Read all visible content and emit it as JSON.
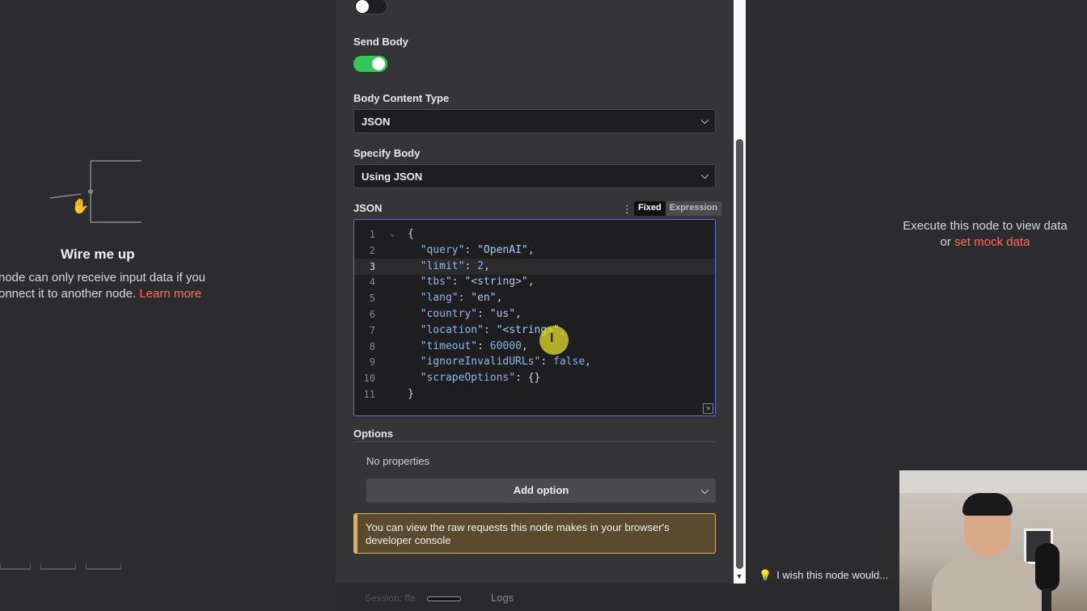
{
  "left": {
    "title": "Wire me up",
    "message": "node can only receive input data if you",
    "message2": "onnect it to another node.",
    "learn_more": "Learn more"
  },
  "params": {
    "send_body_label": "Send Body",
    "body_content_type_label": "Body Content Type",
    "body_content_type_value": "JSON",
    "specify_body_label": "Specify Body",
    "specify_body_value": "Using JSON",
    "json_label": "JSON",
    "mode_fixed": "Fixed",
    "mode_expression": "Expression"
  },
  "json_lines": [
    {
      "n": "1",
      "text": "{"
    },
    {
      "n": "2",
      "key": "\"query\"",
      "value": "\"OpenAI\"",
      "type": "str",
      "trail": ","
    },
    {
      "n": "3",
      "key": "\"limit\"",
      "value": "2",
      "type": "num",
      "trail": ","
    },
    {
      "n": "4",
      "key": "\"tbs\"",
      "value": "\"<string>\"",
      "type": "str",
      "trail": ","
    },
    {
      "n": "5",
      "key": "\"lang\"",
      "value": "\"en\"",
      "type": "str",
      "trail": ","
    },
    {
      "n": "6",
      "key": "\"country\"",
      "value": "\"us\"",
      "type": "str",
      "trail": ","
    },
    {
      "n": "7",
      "key": "\"location\"",
      "value": "\"<string>\"",
      "type": "str",
      "trail": ","
    },
    {
      "n": "8",
      "key": "\"timeout\"",
      "value": "60000",
      "type": "num",
      "trail": ","
    },
    {
      "n": "9",
      "key": "\"ignoreInvalidURLs\"",
      "value": "false",
      "type": "kw",
      "trail": ","
    },
    {
      "n": "10",
      "key": "\"scrapeOptions\"",
      "value": "{}",
      "type": "plain",
      "trail": ""
    },
    {
      "n": "11",
      "text": "}"
    }
  ],
  "options": {
    "title": "Options",
    "empty": "No properties",
    "add_label": "Add option"
  },
  "notice": "You can view the raw requests this node makes in your browser's developer console",
  "right": {
    "message": "Execute this node to view data",
    "or": "or",
    "mock_link": "set mock data",
    "feedback": "I wish this node would..."
  },
  "bottom": {
    "session": "Session: ffa",
    "logs": "Logs"
  },
  "colors": {
    "accent": "#ff6d5a",
    "toggle_on": "#34c759",
    "warning": "#e0b052"
  }
}
